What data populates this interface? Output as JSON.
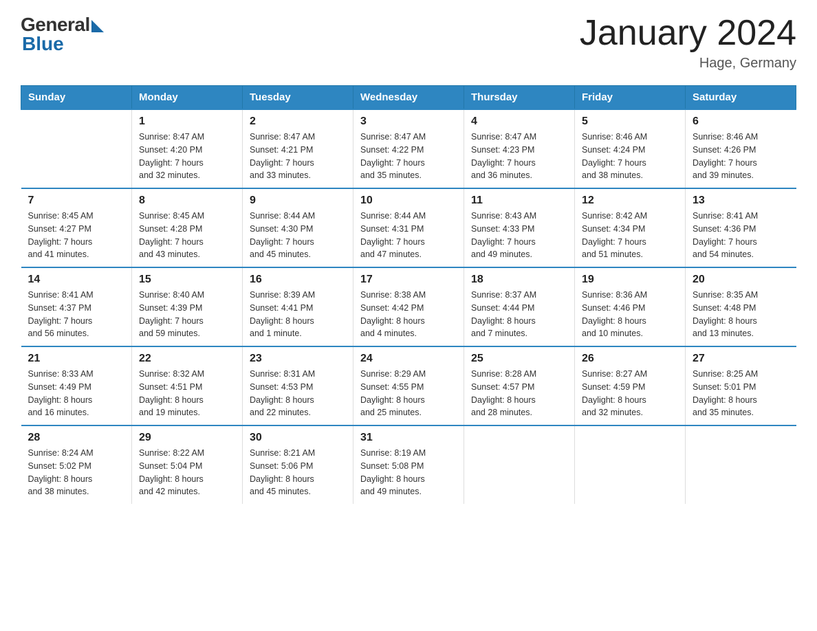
{
  "logo": {
    "general": "General",
    "blue": "Blue"
  },
  "title": "January 2024",
  "location": "Hage, Germany",
  "days_of_week": [
    "Sunday",
    "Monday",
    "Tuesday",
    "Wednesday",
    "Thursday",
    "Friday",
    "Saturday"
  ],
  "weeks": [
    [
      {
        "day": "",
        "info": ""
      },
      {
        "day": "1",
        "info": "Sunrise: 8:47 AM\nSunset: 4:20 PM\nDaylight: 7 hours\nand 32 minutes."
      },
      {
        "day": "2",
        "info": "Sunrise: 8:47 AM\nSunset: 4:21 PM\nDaylight: 7 hours\nand 33 minutes."
      },
      {
        "day": "3",
        "info": "Sunrise: 8:47 AM\nSunset: 4:22 PM\nDaylight: 7 hours\nand 35 minutes."
      },
      {
        "day": "4",
        "info": "Sunrise: 8:47 AM\nSunset: 4:23 PM\nDaylight: 7 hours\nand 36 minutes."
      },
      {
        "day": "5",
        "info": "Sunrise: 8:46 AM\nSunset: 4:24 PM\nDaylight: 7 hours\nand 38 minutes."
      },
      {
        "day": "6",
        "info": "Sunrise: 8:46 AM\nSunset: 4:26 PM\nDaylight: 7 hours\nand 39 minutes."
      }
    ],
    [
      {
        "day": "7",
        "info": "Sunrise: 8:45 AM\nSunset: 4:27 PM\nDaylight: 7 hours\nand 41 minutes."
      },
      {
        "day": "8",
        "info": "Sunrise: 8:45 AM\nSunset: 4:28 PM\nDaylight: 7 hours\nand 43 minutes."
      },
      {
        "day": "9",
        "info": "Sunrise: 8:44 AM\nSunset: 4:30 PM\nDaylight: 7 hours\nand 45 minutes."
      },
      {
        "day": "10",
        "info": "Sunrise: 8:44 AM\nSunset: 4:31 PM\nDaylight: 7 hours\nand 47 minutes."
      },
      {
        "day": "11",
        "info": "Sunrise: 8:43 AM\nSunset: 4:33 PM\nDaylight: 7 hours\nand 49 minutes."
      },
      {
        "day": "12",
        "info": "Sunrise: 8:42 AM\nSunset: 4:34 PM\nDaylight: 7 hours\nand 51 minutes."
      },
      {
        "day": "13",
        "info": "Sunrise: 8:41 AM\nSunset: 4:36 PM\nDaylight: 7 hours\nand 54 minutes."
      }
    ],
    [
      {
        "day": "14",
        "info": "Sunrise: 8:41 AM\nSunset: 4:37 PM\nDaylight: 7 hours\nand 56 minutes."
      },
      {
        "day": "15",
        "info": "Sunrise: 8:40 AM\nSunset: 4:39 PM\nDaylight: 7 hours\nand 59 minutes."
      },
      {
        "day": "16",
        "info": "Sunrise: 8:39 AM\nSunset: 4:41 PM\nDaylight: 8 hours\nand 1 minute."
      },
      {
        "day": "17",
        "info": "Sunrise: 8:38 AM\nSunset: 4:42 PM\nDaylight: 8 hours\nand 4 minutes."
      },
      {
        "day": "18",
        "info": "Sunrise: 8:37 AM\nSunset: 4:44 PM\nDaylight: 8 hours\nand 7 minutes."
      },
      {
        "day": "19",
        "info": "Sunrise: 8:36 AM\nSunset: 4:46 PM\nDaylight: 8 hours\nand 10 minutes."
      },
      {
        "day": "20",
        "info": "Sunrise: 8:35 AM\nSunset: 4:48 PM\nDaylight: 8 hours\nand 13 minutes."
      }
    ],
    [
      {
        "day": "21",
        "info": "Sunrise: 8:33 AM\nSunset: 4:49 PM\nDaylight: 8 hours\nand 16 minutes."
      },
      {
        "day": "22",
        "info": "Sunrise: 8:32 AM\nSunset: 4:51 PM\nDaylight: 8 hours\nand 19 minutes."
      },
      {
        "day": "23",
        "info": "Sunrise: 8:31 AM\nSunset: 4:53 PM\nDaylight: 8 hours\nand 22 minutes."
      },
      {
        "day": "24",
        "info": "Sunrise: 8:29 AM\nSunset: 4:55 PM\nDaylight: 8 hours\nand 25 minutes."
      },
      {
        "day": "25",
        "info": "Sunrise: 8:28 AM\nSunset: 4:57 PM\nDaylight: 8 hours\nand 28 minutes."
      },
      {
        "day": "26",
        "info": "Sunrise: 8:27 AM\nSunset: 4:59 PM\nDaylight: 8 hours\nand 32 minutes."
      },
      {
        "day": "27",
        "info": "Sunrise: 8:25 AM\nSunset: 5:01 PM\nDaylight: 8 hours\nand 35 minutes."
      }
    ],
    [
      {
        "day": "28",
        "info": "Sunrise: 8:24 AM\nSunset: 5:02 PM\nDaylight: 8 hours\nand 38 minutes."
      },
      {
        "day": "29",
        "info": "Sunrise: 8:22 AM\nSunset: 5:04 PM\nDaylight: 8 hours\nand 42 minutes."
      },
      {
        "day": "30",
        "info": "Sunrise: 8:21 AM\nSunset: 5:06 PM\nDaylight: 8 hours\nand 45 minutes."
      },
      {
        "day": "31",
        "info": "Sunrise: 8:19 AM\nSunset: 5:08 PM\nDaylight: 8 hours\nand 49 minutes."
      },
      {
        "day": "",
        "info": ""
      },
      {
        "day": "",
        "info": ""
      },
      {
        "day": "",
        "info": ""
      }
    ]
  ]
}
